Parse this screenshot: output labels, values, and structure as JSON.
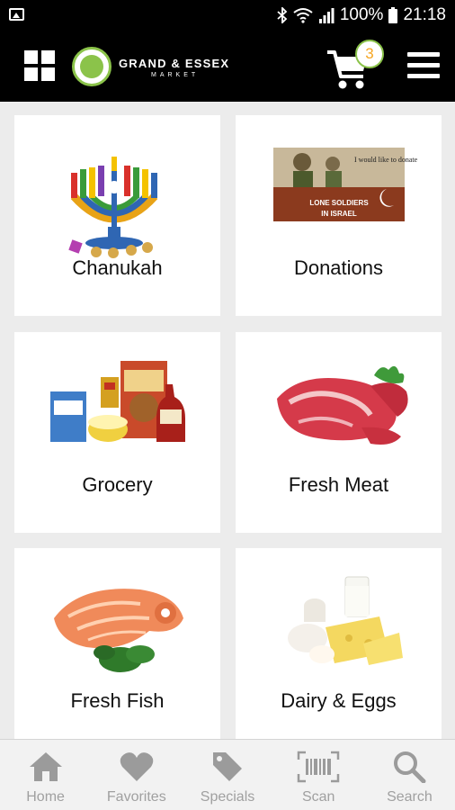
{
  "status_bar": {
    "battery": "100%",
    "time": "21:18"
  },
  "header": {
    "brand": "GRAND & ESSEX",
    "brand_sub": "MARKET",
    "cart_count": "3",
    "accent_color": "#8bc34a",
    "badge_text_color": "#f5a623"
  },
  "categories": [
    {
      "label": "Chanukah",
      "icon": "menorah-image"
    },
    {
      "label": "Donations",
      "icon": "lone-soldiers-banner-image"
    },
    {
      "label": "Grocery",
      "icon": "grocery-products-image"
    },
    {
      "label": "Fresh Meat",
      "icon": "raw-meat-image"
    },
    {
      "label": "Fresh Fish",
      "icon": "salmon-image"
    },
    {
      "label": "Dairy & Eggs",
      "icon": "dairy-products-image"
    }
  ],
  "donation_banner": {
    "line1": "I would like to donate",
    "line2": "LONE SOLDIERS",
    "line3": "IN ISRAEL"
  },
  "bottom_nav": [
    {
      "label": "Home",
      "icon": "home-icon"
    },
    {
      "label": "Favorites",
      "icon": "heart-icon"
    },
    {
      "label": "Specials",
      "icon": "tag-icon"
    },
    {
      "label": "Scan",
      "icon": "barcode-icon"
    },
    {
      "label": "Search",
      "icon": "search-icon"
    }
  ]
}
